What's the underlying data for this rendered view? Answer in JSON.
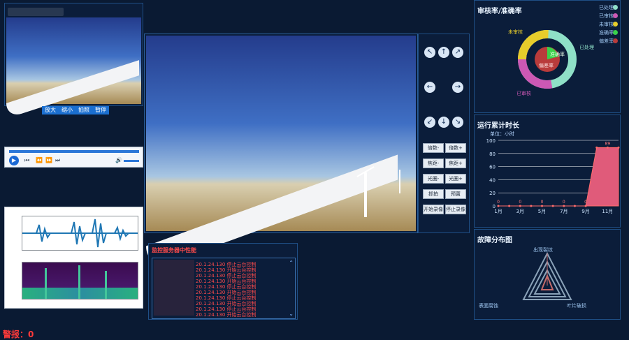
{
  "left_video": {
    "buttons": [
      "放大",
      "缩小",
      "拍照",
      "暂停"
    ]
  },
  "right_panel": {
    "audit_title": "审核率/准确率",
    "legend": [
      {
        "label": "已处理",
        "color": "#8fe0c7"
      },
      {
        "label": "已审核",
        "color": "#cc58b4"
      },
      {
        "label": "未审核",
        "color": "#e7cd2b"
      },
      {
        "label": "准确率",
        "color": "#39d14a"
      },
      {
        "label": "偏差率",
        "color": "#b93b3b"
      }
    ],
    "donut_labels": {
      "outer_left": "未审核",
      "outer_right": "已处理",
      "outer_bottom": "已审核",
      "inner_left": "偏差率",
      "inner_right": "准确率"
    },
    "runtime_title": "运行累计时长",
    "runtime_unit": "单位：小时",
    "fault_title": "故障分布图",
    "fault_labels": [
      "出现裂纹",
      "表面腐蚀",
      "叶片破损"
    ]
  },
  "controls": {
    "button_rows": [
      [
        "倍数-",
        "倍数+"
      ],
      [
        "焦距-",
        "焦距+"
      ],
      [
        "光圈-",
        "光圈+"
      ],
      [
        "抓拍",
        "预置"
      ],
      [
        "开始录像",
        "停止录像"
      ]
    ],
    "arrows": [
      "↖",
      "↑",
      "↗",
      "←",
      "→",
      "↙",
      "↓",
      "↘"
    ]
  },
  "log": {
    "title": "监控服务器中性能",
    "lines": [
      "20.1.24.130 停止云台控制",
      "20.1.24.130 开始云台控制",
      "20.1.24.130 停止云台控制",
      "20.1.24.130 开始云台控制",
      "20.1.24.130 停止云台控制",
      "20.1.24.130 开始云台控制",
      "20.1.24.130 停止云台控制",
      "20.1.24.130 开始云台控制",
      "20.1.24.130 停止云台控制",
      "20.1.24.130 开始云台控制"
    ]
  },
  "status": {
    "alarm_label": "警报：",
    "alarm_value": "0",
    "alarm_color": "#ff3a3a"
  },
  "chart_data": {
    "type": "area",
    "categories": [
      "1月",
      "3月",
      "5月",
      "7月",
      "9月",
      "11月"
    ],
    "points": [
      {
        "x": "1月",
        "y": 0
      },
      {
        "x": "2月",
        "y": 0
      },
      {
        "x": "3月",
        "y": 0
      },
      {
        "x": "4月",
        "y": 0
      },
      {
        "x": "5月",
        "y": 0
      },
      {
        "x": "6月",
        "y": 0
      },
      {
        "x": "7月",
        "y": 0
      },
      {
        "x": "8月",
        "y": 0
      },
      {
        "x": "9月",
        "y": 0
      },
      {
        "x": "10月",
        "y": 89
      },
      {
        "x": "11月",
        "y": 89
      },
      {
        "x": "12月",
        "y": 89
      }
    ],
    "value_labels": [
      {
        "x": "1月",
        "label": "0"
      },
      {
        "x": "3月",
        "label": "0"
      },
      {
        "x": "5月",
        "label": "0"
      },
      {
        "x": "7月",
        "label": "0"
      },
      {
        "x": "9月",
        "label": "0"
      },
      {
        "x": "11月",
        "label": "89"
      }
    ],
    "yticks": [
      0,
      20,
      40,
      60,
      80,
      100
    ],
    "ylim": [
      0,
      100
    ],
    "grid": true,
    "fill": "#e05b7a",
    "stroke": "#ff6b6b"
  }
}
